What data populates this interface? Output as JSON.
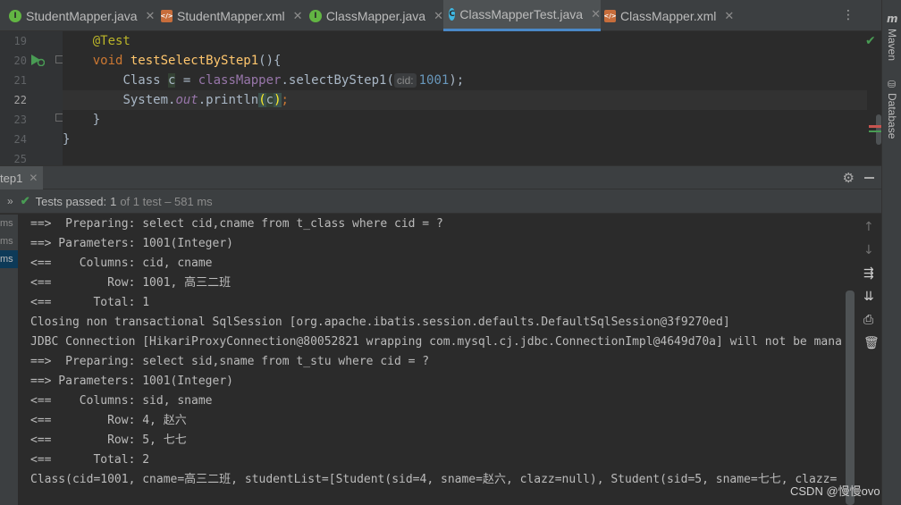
{
  "tabs": [
    {
      "label": "StudentMapper.java",
      "icon": "interface-icon",
      "active": false
    },
    {
      "label": "StudentMapper.xml",
      "icon": "xml-file-icon",
      "active": false
    },
    {
      "label": "ClassMapper.java",
      "icon": "interface-icon",
      "active": false
    },
    {
      "label": "ClassMapperTest.java",
      "icon": "class-icon",
      "active": true
    },
    {
      "label": "ClassMapper.xml",
      "icon": "xml-file-icon",
      "active": false
    }
  ],
  "right_panel": {
    "maven": "Maven",
    "database": "Database"
  },
  "editor": {
    "line_numbers": [
      "19",
      "20",
      "21",
      "22",
      "23",
      "24",
      "25"
    ],
    "annotation": "@Test",
    "kw_void": "void",
    "method": "testSelectByStep1",
    "paren_open": "(){",
    "class_kw": "Class ",
    "var_c": "c",
    "assign": " = ",
    "mapper": "classMapper",
    "call": ".selectByStep1(",
    "hint": "cid:",
    "arg": "1001",
    "call_end": ");",
    "sys": "System.",
    "out": "out",
    "println": ".println",
    "lp": "(",
    "c": "c",
    "rp": ")",
    "semi": ";",
    "close_method": "}",
    "close_class": "}"
  },
  "run": {
    "tab_label": "tep1",
    "status_label": "Tests passed:",
    "status_count": "1",
    "status_of": "of 1 test – 581 ms",
    "tree_items": [
      "ms",
      "ms",
      "ms"
    ]
  },
  "console_lines": [
    "==>  Preparing: select cid,cname from t_class where cid = ?",
    "==> Parameters: 1001(Integer)",
    "<==    Columns: cid, cname",
    "<==        Row: 1001, 高三二班",
    "<==      Total: 1",
    "Closing non transactional SqlSession [org.apache.ibatis.session.defaults.DefaultSqlSession@3f9270ed]",
    "JDBC Connection [HikariProxyConnection@80052821 wrapping com.mysql.cj.jdbc.ConnectionImpl@4649d70a] will not be mana",
    "==>  Preparing: select sid,sname from t_stu where cid = ?",
    "==> Parameters: 1001(Integer)",
    "<==    Columns: sid, sname",
    "<==        Row: 4, 赵六",
    "<==        Row: 5, 七七",
    "<==      Total: 2",
    "Class(cid=1001, cname=高三二班, studentList=[Student(sid=4, sname=赵六, clazz=null), Student(sid=5, sname=七七, clazz="
  ],
  "watermark": "CSDN @慢慢ovo",
  "colors": {
    "accent": "#4a88c7",
    "pass": "#499c54",
    "keyword": "#cc7832",
    "method": "#ffc66d",
    "number": "#6897bb"
  }
}
